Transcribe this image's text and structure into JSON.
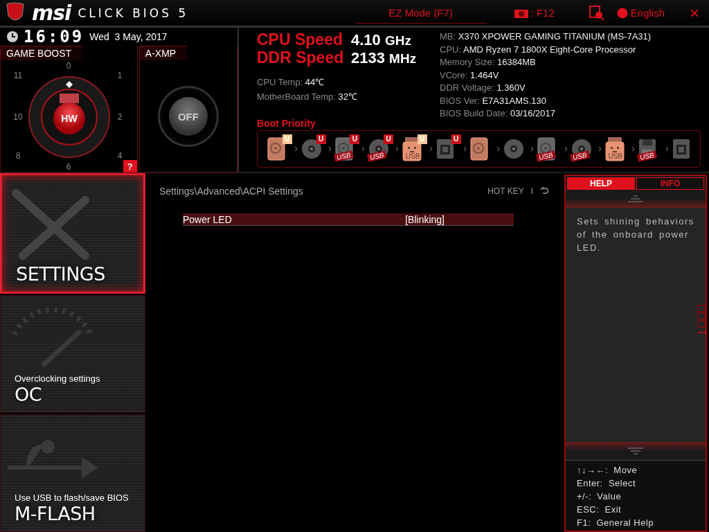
{
  "top_bar": {
    "brand": "msi",
    "product": "CLICK BIOS 5",
    "ez_mode": "EZ Mode (F7)",
    "screenshot_key": ": F12",
    "language": "English",
    "close": "×"
  },
  "clock": {
    "time": "16:09",
    "date": "Wed  3 May, 2017"
  },
  "game_boost": {
    "title": "GAME BOOST",
    "dial_numbers": [
      "0",
      "11",
      "1",
      "10",
      "2",
      "8",
      "4",
      "6"
    ],
    "button": "HW",
    "help": "?"
  },
  "axmp": {
    "title": "A-XMP",
    "button": "OFF"
  },
  "speeds": [
    {
      "label": "CPU Speed",
      "value": "4.10",
      "unit": "GHz"
    },
    {
      "label": "DDR Speed",
      "value": "2133",
      "unit": "MHz"
    }
  ],
  "temps": [
    {
      "label": "CPU Temp:",
      "value": "44℃"
    },
    {
      "label": "MotherBoard Temp:",
      "value": "32℃"
    }
  ],
  "system_info": [
    {
      "label": "MB:",
      "value": "X370 XPOWER GAMING TITANIUM (MS-7A31)"
    },
    {
      "label": "CPU:",
      "value": "AMD Ryzen 7 1800X Eight-Core Processor"
    },
    {
      "label": "Memory Size:",
      "value": "16384MB"
    },
    {
      "label": "VCore:",
      "value": "1.464V"
    },
    {
      "label": "DDR Voltage:",
      "value": "1.360V"
    },
    {
      "label": "BIOS Ver:",
      "value": "E7A31AMS.130"
    },
    {
      "label": "BIOS Build Date:",
      "value": "03/16/2017"
    }
  ],
  "boot_priority": {
    "title": "Boot Priority",
    "devices": [
      {
        "kind": "hdd",
        "badge": "U",
        "highlighted": true
      },
      {
        "kind": "optical",
        "badge": "U",
        "highlighted": false
      },
      {
        "kind": "hdd",
        "badge": "U",
        "label": "USB",
        "highlighted": false
      },
      {
        "kind": "optical",
        "badge": "U",
        "label": "USB",
        "highlighted": false
      },
      {
        "kind": "usbkey",
        "badge": "U",
        "label": "USB",
        "highlighted": true
      },
      {
        "kind": "network",
        "badge": "U",
        "highlighted": false
      },
      {
        "kind": "hdd",
        "highlighted": true
      },
      {
        "kind": "optical",
        "highlighted": false
      },
      {
        "kind": "hdd",
        "label": "USB",
        "highlighted": false
      },
      {
        "kind": "optical",
        "label": "USB",
        "highlighted": false
      },
      {
        "kind": "usbkey",
        "label": "USB",
        "highlighted": true
      },
      {
        "kind": "floppy",
        "label": "USB",
        "highlighted": false
      },
      {
        "kind": "network",
        "highlighted": false
      }
    ]
  },
  "nav": [
    {
      "kind": "settings",
      "title": "SETTINGS",
      "selected": true
    },
    {
      "kind": "oc",
      "subtitle": "Overclocking settings",
      "title": "OC",
      "selected": false
    },
    {
      "kind": "mflash",
      "subtitle": "Use USB to flash/save BIOS",
      "title": "M-FLASH",
      "selected": false
    }
  ],
  "content": {
    "breadcrumb": "Settings\\Advanced\\ACPI Settings",
    "hot_key": "HOT KEY",
    "separator": "I",
    "rows": [
      {
        "label": "Power LED",
        "value": "[Blinking]",
        "selected": true
      }
    ]
  },
  "help_panel": {
    "tabs": [
      {
        "label": "HELP",
        "selected": true
      },
      {
        "label": "INFO",
        "selected": false
      }
    ],
    "text": "Sets shining behaviors of the onboard power LED.",
    "keys": [
      "↑↓→←:  Move",
      "Enter:  Select",
      "+/-:  Value",
      "ESC:  Exit",
      "F1:  General Help"
    ]
  }
}
